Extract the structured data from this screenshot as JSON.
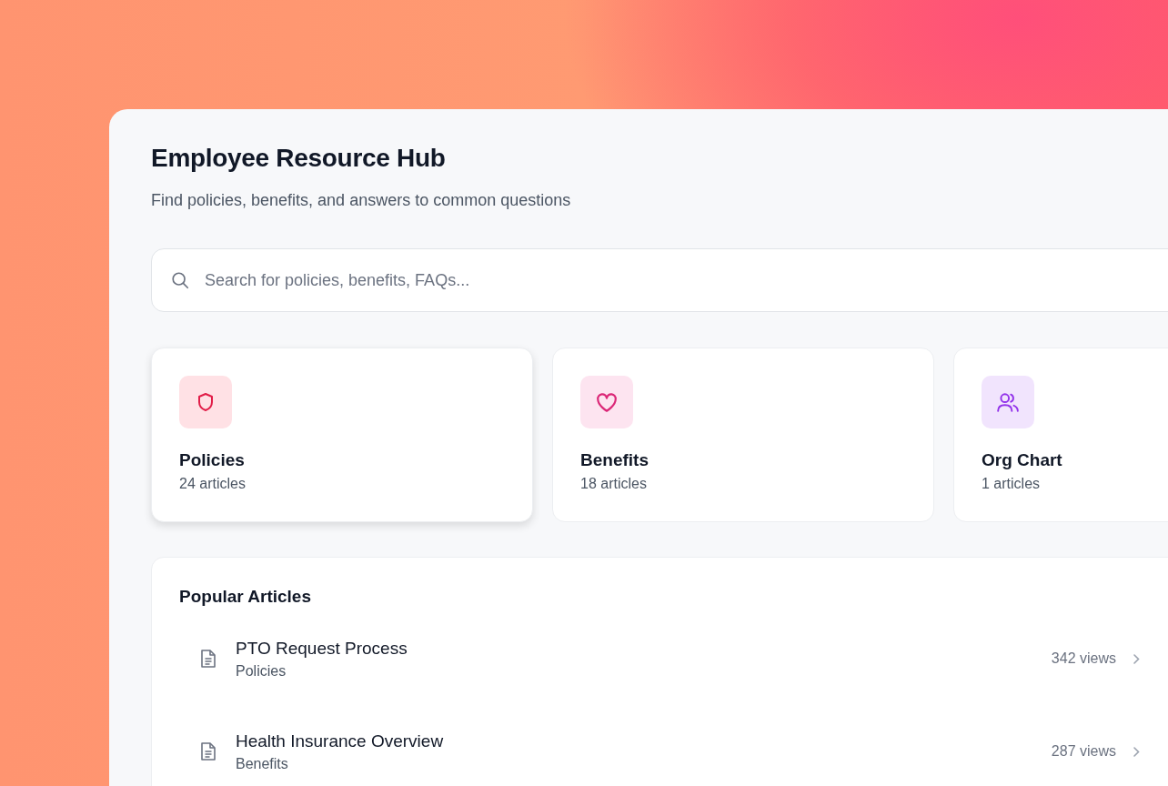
{
  "header": {
    "title": "Employee Resource Hub",
    "subtitle": "Find policies, benefits, and answers to common questions"
  },
  "search": {
    "placeholder": "Search for policies, benefits, FAQs..."
  },
  "categories": [
    {
      "kind": "shield",
      "name": "Policies",
      "count": "24 articles",
      "color": "#e11d48",
      "highlighted": true
    },
    {
      "kind": "heart",
      "name": "Benefits",
      "count": "18 articles",
      "color": "#db2777",
      "highlighted": false
    },
    {
      "kind": "people",
      "name": "Org Chart",
      "count": "1 articles",
      "color": "#9333ea",
      "highlighted": false
    }
  ],
  "popular": {
    "title": "Popular Articles",
    "articles": [
      {
        "title": "PTO Request Process",
        "category": "Policies",
        "views": "342 views"
      },
      {
        "title": "Health Insurance Overview",
        "category": "Benefits",
        "views": "287 views"
      }
    ]
  }
}
